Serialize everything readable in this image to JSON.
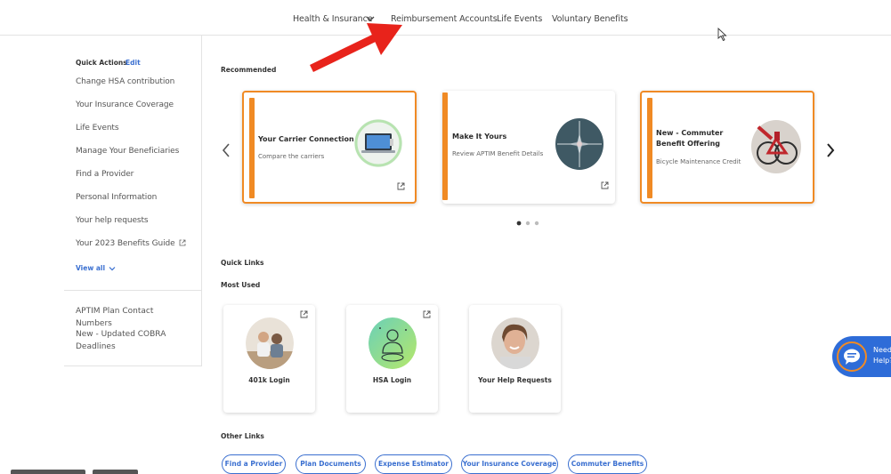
{
  "topnav": {
    "items": [
      "Health & Insurance",
      "Reimbursement Accounts",
      "Life Events",
      "Voluntary Benefits"
    ]
  },
  "sidebar": {
    "quick_actions_label": "Quick Actions",
    "edit_label": "Edit",
    "links": [
      "Change HSA contribution",
      "Your Insurance Coverage",
      "Life Events",
      "Manage Your Beneficiaries",
      "Find a Provider",
      "Personal Information",
      "Your help requests",
      "Your 2023 Benefits Guide"
    ],
    "view_all_label": "View all",
    "secondary_links": [
      "APTIM Plan Contact Numbers",
      "New - Updated COBRA Deadlines"
    ]
  },
  "recommended": {
    "heading": "Recommended",
    "cards": [
      {
        "title": "Your Carrier Connection",
        "subtitle": "Compare the carriers"
      },
      {
        "title": "Make It Yours",
        "subtitle": "Review APTIM Benefit Details"
      },
      {
        "title": "New - Commuter Benefit Offering",
        "subtitle": "Bicycle Maintenance Credit"
      }
    ]
  },
  "quick_links": {
    "heading": "Quick Links",
    "subheading": "Most Used",
    "items": [
      {
        "label": "401k Login"
      },
      {
        "label": "HSA Login"
      },
      {
        "label": "Your Help Requests"
      }
    ]
  },
  "other_links": {
    "heading": "Other Links",
    "pills": [
      "Find a Provider",
      "Plan Documents",
      "Expense Estimator",
      "Your Insurance Coverage",
      "Commuter Benefits"
    ]
  },
  "chat": {
    "label": "Need Help?"
  },
  "colors": {
    "accent_orange": "#f08a24",
    "link_blue": "#3a6fd0",
    "annotation_red": "#e8231b"
  }
}
